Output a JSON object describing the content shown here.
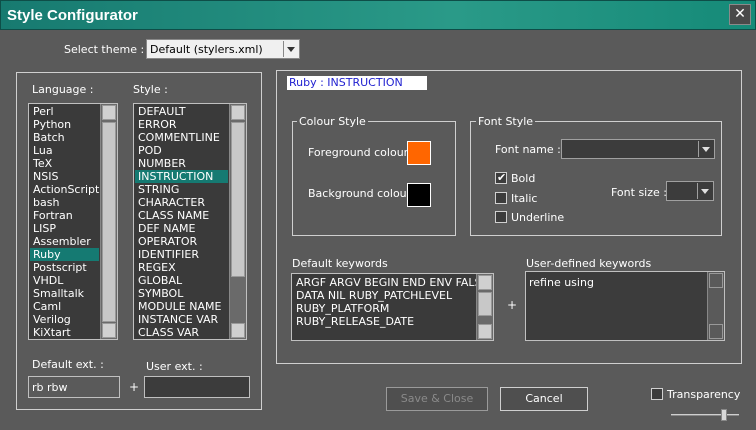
{
  "window": {
    "title": "Style Configurator",
    "close_glyph": "✕"
  },
  "theme": {
    "label": "Select theme :",
    "value": "Default (stylers.xml)"
  },
  "language": {
    "label": "Language :",
    "items": [
      "Perl",
      "Python",
      "Batch",
      "Lua",
      "TeX",
      "NSIS",
      "ActionScript",
      "bash",
      "Fortran",
      "LISP",
      "Assembler",
      "Ruby",
      "Postscript",
      "VHDL",
      "Smalltalk",
      "Caml",
      "Verilog",
      "KiXtart"
    ],
    "selected_index": 11
  },
  "style": {
    "label": "Style :",
    "items": [
      "DEFAULT",
      "ERROR",
      "COMMENTLINE",
      "POD",
      "NUMBER",
      "INSTRUCTION",
      "STRING",
      "CHARACTER",
      "CLASS NAME",
      "DEF NAME",
      "OPERATOR",
      "IDENTIFIER",
      "REGEX",
      "GLOBAL",
      "SYMBOL",
      "MODULE NAME",
      "INSTANCE VAR",
      "CLASS VAR"
    ],
    "selected_index": 5
  },
  "ext": {
    "default_label": "Default ext. :",
    "default_value": "rb rbw",
    "plus": "+",
    "user_label": "User ext. :",
    "user_value": ""
  },
  "current": {
    "value": "Ruby : INSTRUCTION"
  },
  "colour_style": {
    "title": "Colour Style",
    "fg_label": "Foreground colour",
    "fg_color": "#ff6600",
    "bg_label": "Background colour",
    "bg_color": "#000000"
  },
  "font_style": {
    "title": "Font Style",
    "name_label": "Font name :",
    "name_value": "",
    "bold_label": "Bold",
    "bold_checked": true,
    "italic_label": "Italic",
    "italic_checked": false,
    "underline_label": "Underline",
    "underline_checked": false,
    "size_label": "Font size :",
    "size_value": ""
  },
  "keywords": {
    "default_label": "Default keywords",
    "default_lines": [
      "ARGF ARGV BEGIN END ENV FALSE",
      "DATA NIL RUBY_PATCHLEVEL",
      "RUBY_PLATFORM",
      "RUBY_RELEASE_DATE"
    ],
    "plus": "+",
    "user_label": "User-defined keywords",
    "user_value": "refine using"
  },
  "buttons": {
    "save_close": "Save & Close",
    "cancel": "Cancel"
  },
  "transparency": {
    "label": "Transparency",
    "checked": false,
    "level": 0.8
  },
  "colors": {
    "accent": "#157a72",
    "title_bar": "#1f8a7c",
    "background": "#5a5a5a"
  }
}
